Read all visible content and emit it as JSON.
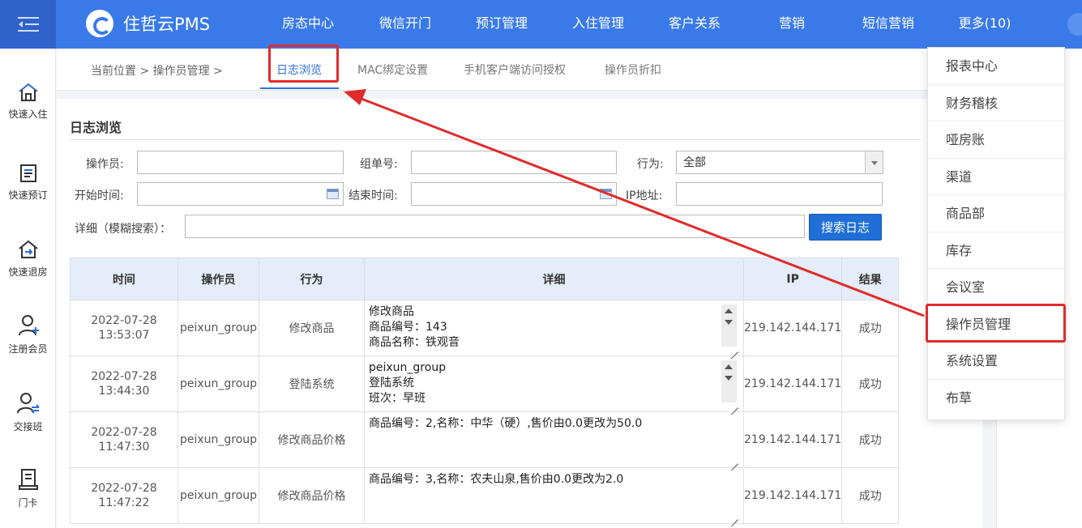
{
  "app": {
    "name": "住哲云PMS"
  },
  "nav": {
    "items": [
      "房态中心",
      "微信开门",
      "预订管理",
      "入住管理",
      "客户关系",
      "营销",
      "短信营销",
      "更多(10)"
    ]
  },
  "sidebar": {
    "items": [
      {
        "label": "快速入住",
        "icon": "home-icon"
      },
      {
        "label": "快速预订",
        "icon": "document-icon"
      },
      {
        "label": "快速退房",
        "icon": "house-exit-icon"
      },
      {
        "label": "注册会员",
        "icon": "user-add-icon"
      },
      {
        "label": "交接班",
        "icon": "user-switch-icon"
      },
      {
        "label": "门卡",
        "icon": "card-icon"
      }
    ]
  },
  "breadcrumb": {
    "prefix": "当前位置",
    "path": "操作员管理",
    "sep": ">"
  },
  "tabs": [
    "日志浏览",
    "MAC绑定设置",
    "手机客户端访问授权",
    "操作员折扣"
  ],
  "section": {
    "title": "日志浏览"
  },
  "filters": {
    "operator_label": "操作员:",
    "group_label": "组单号:",
    "action_label": "行为:",
    "action_value": "全部",
    "start_label": "开始时间:",
    "end_label": "结束时间:",
    "ip_label": "IP地址:",
    "detail_label": "详细（模糊搜索）：",
    "search_button": "搜索日志"
  },
  "table": {
    "headers": [
      "时间",
      "操作员",
      "行为",
      "详细",
      "IP",
      "结果"
    ],
    "rows": [
      {
        "date": "2022-07-28",
        "time": "13:53:07",
        "operator": "peixun_group",
        "action": "修改商品",
        "detail": [
          "修改商品",
          "商品编号：143",
          "商品名称：铁观音"
        ],
        "ip": "219.142.144.171",
        "result": "成功"
      },
      {
        "date": "2022-07-28",
        "time": "13:44:30",
        "operator": "peixun_group",
        "action": "登陆系统",
        "detail": [
          "peixun_group",
          "登陆系统",
          "班次：早班"
        ],
        "ip": "219.142.144.171",
        "result": "成功"
      },
      {
        "date": "2022-07-28",
        "time": "11:47:30",
        "operator": "peixun_group",
        "action": "修改商品价格",
        "detail": [
          "商品编号：2,名称：中华（硬）,售价由0.0更改为50.0"
        ],
        "ip": "219.142.144.171",
        "result": "成功"
      },
      {
        "date": "2022-07-28",
        "time": "11:47:22",
        "operator": "peixun_group",
        "action": "修改商品价格",
        "detail": [
          "商品编号：3,名称：农夫山泉,售价由0.0更改为2.0"
        ],
        "ip": "219.142.144.171",
        "result": "成功"
      }
    ]
  },
  "dropdown": {
    "items": [
      "报表中心",
      "财务稽核",
      "哑房账",
      "渠道",
      "商品部",
      "库存",
      "会议室",
      "操作员管理",
      "系统设置",
      "布草"
    ]
  },
  "colors": {
    "brand": "#3a7ae8",
    "highlight": "#e02b2b",
    "button": "#1f6fd6"
  }
}
